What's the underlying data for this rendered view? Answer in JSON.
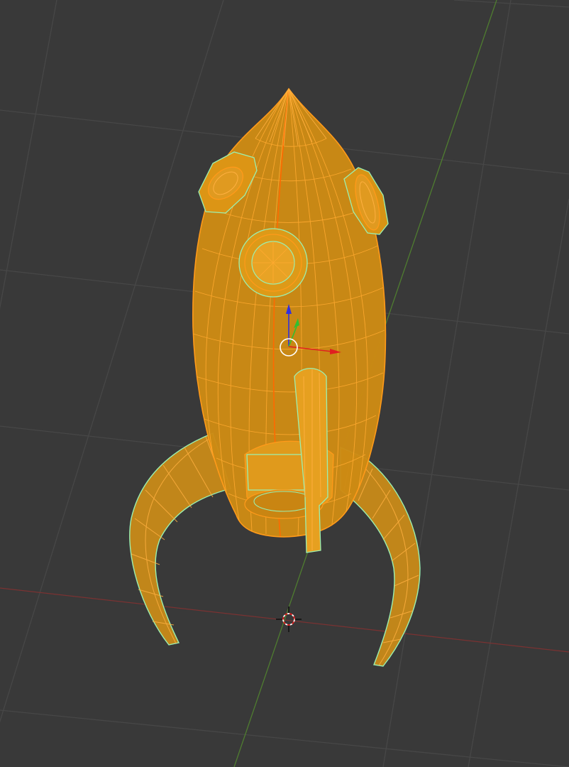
{
  "viewport": {
    "view": "3D Viewport",
    "shading": "wireframe",
    "selected_object": "rocket-mesh",
    "background_color": "#393939"
  },
  "colors": {
    "grid_line": "#4a4a4a",
    "axis_x": "#8b3a3a",
    "axis_y": "#5a8a3a",
    "mesh_fill": "#f4a300",
    "mesh_edge": "#ff9a1a",
    "mesh_edge_highlight": "#9bf0b0",
    "gizmo_x": "#e02020",
    "gizmo_y": "#30c030",
    "gizmo_z": "#3030e0"
  },
  "icons": {
    "gizmo": "transform-gizmo-icon",
    "cursor": "3d-cursor-icon"
  }
}
